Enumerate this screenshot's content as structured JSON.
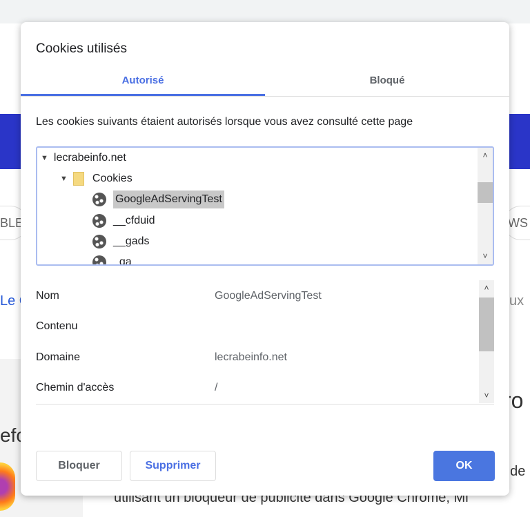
{
  "background": {
    "pill_left": "BLE",
    "pill_right": "WS",
    "link_left": "Le C",
    "link_right": "ux",
    "heading_right": "ro",
    "heading_left": "efo",
    "text_right": "t de",
    "text_bottom": "utilisant un bloqueur de publicité dans Google Chrome, Mi"
  },
  "dialog": {
    "title": "Cookies utilisés",
    "tabs": [
      {
        "label": "Autorisé",
        "active": true
      },
      {
        "label": "Bloqué",
        "active": false
      }
    ],
    "description": "Les cookies suivants étaient autorisés lorsque vous avez consulté cette page",
    "tree": {
      "site": "lecrabeinfo.net",
      "folder": "Cookies",
      "cookies": [
        "GoogleAdServingTest",
        "__cfduid",
        "__gads",
        "_ga"
      ],
      "selected": "GoogleAdServingTest"
    },
    "details": [
      {
        "key": "Nom",
        "value": "GoogleAdServingTest"
      },
      {
        "key": "Contenu",
        "value": ""
      },
      {
        "key": "Domaine",
        "value": "lecrabeinfo.net"
      },
      {
        "key": "Chemin d'accès",
        "value": "/"
      }
    ],
    "buttons": {
      "block": "Bloquer",
      "delete": "Supprimer",
      "ok": "OK"
    },
    "accent_color": "#4a76e0"
  }
}
